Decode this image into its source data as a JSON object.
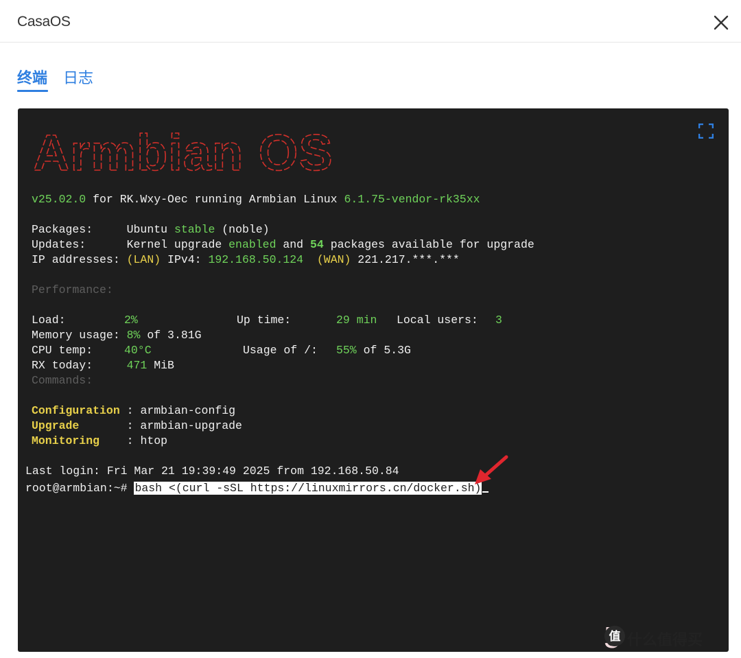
{
  "app": {
    "title": "CasaOS"
  },
  "tabs": [
    {
      "label": "终端",
      "active": true
    },
    {
      "label": "日志",
      "active": false
    }
  ],
  "terminal": {
    "banner_text": "Armbian OS",
    "motd": {
      "version": "v25.02.0",
      "for_text": " for RK.Wxy-Oec running Armbian Linux ",
      "kernel": "6.1.75-vendor-rk35xx",
      "packages_label": "Packages:     ",
      "packages_os": "Ubuntu ",
      "packages_channel": "stable",
      "packages_codename": " (noble)",
      "updates_label": "Updates:      ",
      "updates_prefix": "Kernel upgrade ",
      "updates_enabled": "enabled",
      "updates_and": " and ",
      "updates_count": "54",
      "updates_suffix": " packages available for upgrade",
      "ip_label": "IP addresses: ",
      "ip_lan_tag": "(LAN)",
      "ip_ipv4_label": " IPv4: ",
      "ip_lan": "192.168.50.124",
      "ip_wan_tag": "(WAN)",
      "ip_wan": " 221.217.***.***",
      "performance_label": "Performance:",
      "load_label": "Load:         ",
      "load_value": "2%",
      "uptime_label": "Up time:       ",
      "uptime_value": "29 min",
      "users_label": "Local users:   ",
      "users_value": "3",
      "memory_label": "Memory usage: ",
      "memory_pct": "8%",
      "memory_rest": " of 3.81G",
      "cpu_label": "CPU temp:     ",
      "cpu_value": "40°C",
      "usage_label": "Usage of /:   ",
      "usage_pct": "55%",
      "usage_rest": " of 5.3G",
      "rx_label": "RX today:     ",
      "rx_value": "471",
      "rx_unit": " MiB",
      "commands_label": "Commands:",
      "cmd1_name": "Configuration",
      "cmd1_value": " : armbian-config",
      "cmd2_name": "Upgrade",
      "cmd2_value": "       : armbian-upgrade",
      "cmd3_name": "Monitoring",
      "cmd3_value": "    : htop"
    },
    "last_login": "Last login: Fri Mar 21 19:39:49 2025 from 192.168.50.84",
    "prompt": "root@armbian:~# ",
    "command": "bash <(curl -sSL https://linuxmirrors.cn/docker.sh)"
  },
  "watermark": {
    "text": "什么值得买",
    "ghost": "5"
  },
  "colors": {
    "accent": "#2f7fe0",
    "terminal_bg": "#1e1e1e",
    "green": "#6fd35a",
    "yellow": "#e8d04a",
    "banner_red": "#d0302a",
    "arrow_red": "#e0262e"
  }
}
